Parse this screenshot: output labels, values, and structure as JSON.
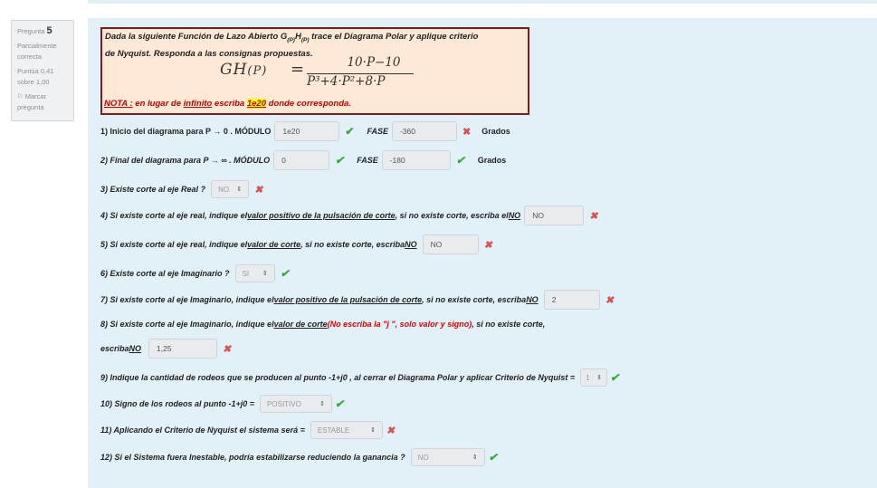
{
  "info": {
    "question_label": "Pregunta",
    "question_number": "5",
    "status": "Parcialmente correcta",
    "score": "Puntúa 0,41 sobre 1,00",
    "flag_label": "Marcar pregunta"
  },
  "question": {
    "intro_a": "Dada la siguiente Función de Lazo Abierto  G",
    "sub_1": "(P)",
    "intro_h": "H",
    "sub_2": "(P)",
    "intro_b": " trace el Diagrama Polar y aplique criterio",
    "intro_line2": "de Nyquist. Responda a las consignas propuestas.",
    "formula_lhs": "GH",
    "formula_lhs_arg": "(P)",
    "formula_eq": "=",
    "formula_num": "10·P−10",
    "formula_den": "P³+4·P²+8·P",
    "nota_prefix": "NOTA :",
    "nota_a": " en lugar de ",
    "nota_word": "infinito",
    "nota_b": " escriba ",
    "nota_value": "1e20",
    "nota_c": " donde corresponda."
  },
  "q1": {
    "text": "1) Inicio del diagrama para P → 0 . MÓDULO",
    "modulo": "1e20",
    "fase_label": "FASE",
    "fase": "-360",
    "unit": "Grados"
  },
  "q2": {
    "text": "2) Final del diagrama para P → ∞ . MÓDULO",
    "modulo": "0",
    "fase_label": "FASE",
    "fase": "-180",
    "unit": "Grados"
  },
  "q3": {
    "text": "3) Existe corte al eje Real ?",
    "value": "NO"
  },
  "q4": {
    "a": "4) Si existe corte al eje real, indique el ",
    "u": "valor positivo de la pulsación de corte",
    "b": ", si no existe corte, escriba el ",
    "no": "NO",
    "value": "NO"
  },
  "q5": {
    "a": "5) Si existe corte al eje real, indique el ",
    "u": "valor de corte",
    "b": ", si no existe corte, escriba ",
    "no": "NO",
    "value": "NO"
  },
  "q6": {
    "text": "6) Existe corte al eje Imaginario ?",
    "value": "SI"
  },
  "q7": {
    "a": "7) Si existe corte al eje Imaginario, indique el ",
    "u": "valor positivo de la pulsación de corte",
    "b": ", si no existe corte, escriba ",
    "no": "NO",
    "value": "2"
  },
  "q8": {
    "a": "8) Si existe corte al eje Imaginario, indique el ",
    "u": "valor de corte",
    "red": " (No escriba la \"j \", solo valor y signo)",
    "b": " , si no existe corte,",
    "c": "escriba ",
    "no": "NO",
    "value": "1,25"
  },
  "q9": {
    "text": "9) Indique la cantidad de rodeos que se producen al punto -1+j0 , al cerrar el Diagrama Polar y aplicar Criterio de Nyquist =",
    "value": "1"
  },
  "q10": {
    "text": "10) Signo de los rodeos al punto -1+j0 =",
    "value": "POSITIVO"
  },
  "q11": {
    "text": "11) Aplicando el Criterio de Nyquist el sistema será =",
    "value": "ESTABLE"
  },
  "q12": {
    "text": "12) Si el Sistema fuera Inestable, podría estabilizarse reduciendo la ganancia ?",
    "value": "NO"
  },
  "marks": {
    "ok": "✔",
    "bad": "✖",
    "arrow": "⇕",
    "flag": "⚐"
  }
}
